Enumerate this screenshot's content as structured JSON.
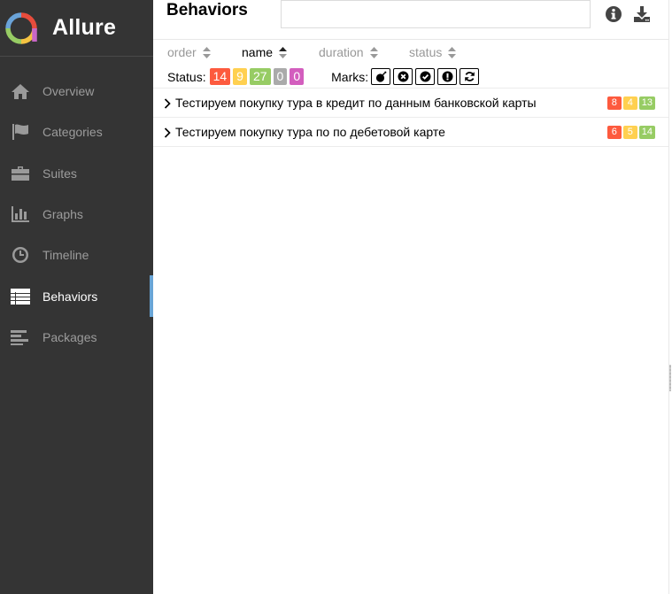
{
  "app": {
    "name": "Allure",
    "logo_colors": [
      "#e74c3c",
      "#f5c342",
      "#97cc64",
      "#6aa3d8",
      "#c966c7"
    ]
  },
  "sidebar": {
    "items": [
      {
        "label": "Overview",
        "icon": "home-icon",
        "active": false
      },
      {
        "label": "Categories",
        "icon": "flag-icon",
        "active": false
      },
      {
        "label": "Suites",
        "icon": "briefcase-icon",
        "active": false
      },
      {
        "label": "Graphs",
        "icon": "bar-chart-icon",
        "active": false
      },
      {
        "label": "Timeline",
        "icon": "clock-icon",
        "active": false
      },
      {
        "label": "Behaviors",
        "icon": "list-icon",
        "active": true
      },
      {
        "label": "Packages",
        "icon": "align-left-icon",
        "active": false
      }
    ],
    "active_color": "#69a5d6"
  },
  "main": {
    "title": "Behaviors",
    "search": {
      "value": "",
      "placeholder": ""
    },
    "toolbar": {
      "info_icon": "info-circle-icon",
      "download_icon": "download-icon"
    },
    "sorters": [
      {
        "label": "order",
        "active": false
      },
      {
        "label": "name",
        "active": true
      },
      {
        "label": "duration",
        "active": false
      },
      {
        "label": "status",
        "active": false
      }
    ],
    "status_filter": {
      "label": "Status:",
      "badges": [
        {
          "value": "14",
          "status": "failed",
          "color": "#fd5a3e"
        },
        {
          "value": "9",
          "status": "broken",
          "color": "#ffd050"
        },
        {
          "value": "27",
          "status": "passed",
          "color": "#97cc64"
        },
        {
          "value": "0",
          "status": "skipped",
          "color": "#aaaaaa"
        },
        {
          "value": "0",
          "status": "unknown",
          "color": "#d35ebe"
        }
      ]
    },
    "marks": {
      "label": "Marks:",
      "items": [
        {
          "icon": "bomb-icon"
        },
        {
          "icon": "times-circle-icon"
        },
        {
          "icon": "check-circle-icon"
        },
        {
          "icon": "exclamation-circle-icon"
        },
        {
          "icon": "refresh-icon"
        }
      ]
    },
    "rows": [
      {
        "title": "Тестируем покупку тура в кредит по данным банковской карты",
        "counts": [
          {
            "value": "8",
            "color": "#fd5a3e"
          },
          {
            "value": "4",
            "color": "#ffd050"
          },
          {
            "value": "13",
            "color": "#97cc64"
          }
        ]
      },
      {
        "title": "Тестируем покупку тура по по дебетовой карте",
        "counts": [
          {
            "value": "6",
            "color": "#fd5a3e"
          },
          {
            "value": "5",
            "color": "#ffd050"
          },
          {
            "value": "14",
            "color": "#97cc64"
          }
        ]
      }
    ]
  }
}
